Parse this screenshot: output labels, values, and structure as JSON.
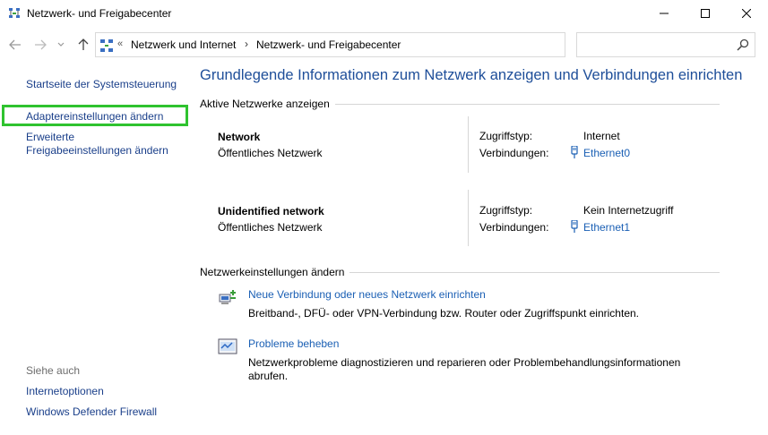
{
  "window": {
    "title": "Netzwerk- und Freigabecenter"
  },
  "address": {
    "overflow": "«",
    "crumbs": [
      "Netzwerk und Internet",
      "Netzwerk- und Freigabecenter"
    ],
    "search_placeholder": ""
  },
  "sidebar": {
    "links": [
      "Startseite der Systemsteuerung",
      "Adaptereinstellungen ändern",
      "Erweiterte Freigabeeinstellungen ändern"
    ],
    "links_multiline": {
      "line1": "Erweiterte",
      "line2": "Freigabeeinstellungen ändern"
    },
    "see_also": "Siehe auch",
    "see_also_links": [
      "Internetoptionen",
      "Windows Defender Firewall"
    ]
  },
  "main": {
    "title": "Grundlegende Informationen zum Netzwerk anzeigen und Verbindungen einrichten",
    "active_networks_header": "Aktive Netzwerke anzeigen",
    "networks": [
      {
        "name": "Network",
        "category": "Öffentliches Netzwerk",
        "access_label": "Zugriffstyp:",
        "access_value": "Internet",
        "conn_label": "Verbindungen:",
        "conn_value": "Ethernet0"
      },
      {
        "name": "Unidentified network",
        "category": "Öffentliches Netzwerk",
        "access_label": "Zugriffstyp:",
        "access_value": "Kein Internetzugriff",
        "conn_label": "Verbindungen:",
        "conn_value": "Ethernet1"
      }
    ],
    "change_settings_header": "Netzwerkeinstellungen ändern",
    "tasks": [
      {
        "link": "Neue Verbindung oder neues Netzwerk einrichten",
        "desc": "Breitband-, DFÜ- oder VPN-Verbindung bzw. Router oder Zugriffspunkt einrichten.",
        "icon": "new-connection-icon"
      },
      {
        "link": "Probleme beheben",
        "desc_line1": "Netzwerkprobleme diagnostizieren und reparieren oder Problembehandlungsinformationen",
        "desc_line2": "abrufen.",
        "icon": "troubleshoot-icon"
      }
    ]
  },
  "colors": {
    "link": "#1a5fb4",
    "title": "#1e4e99",
    "highlight": "#2fc32f"
  }
}
